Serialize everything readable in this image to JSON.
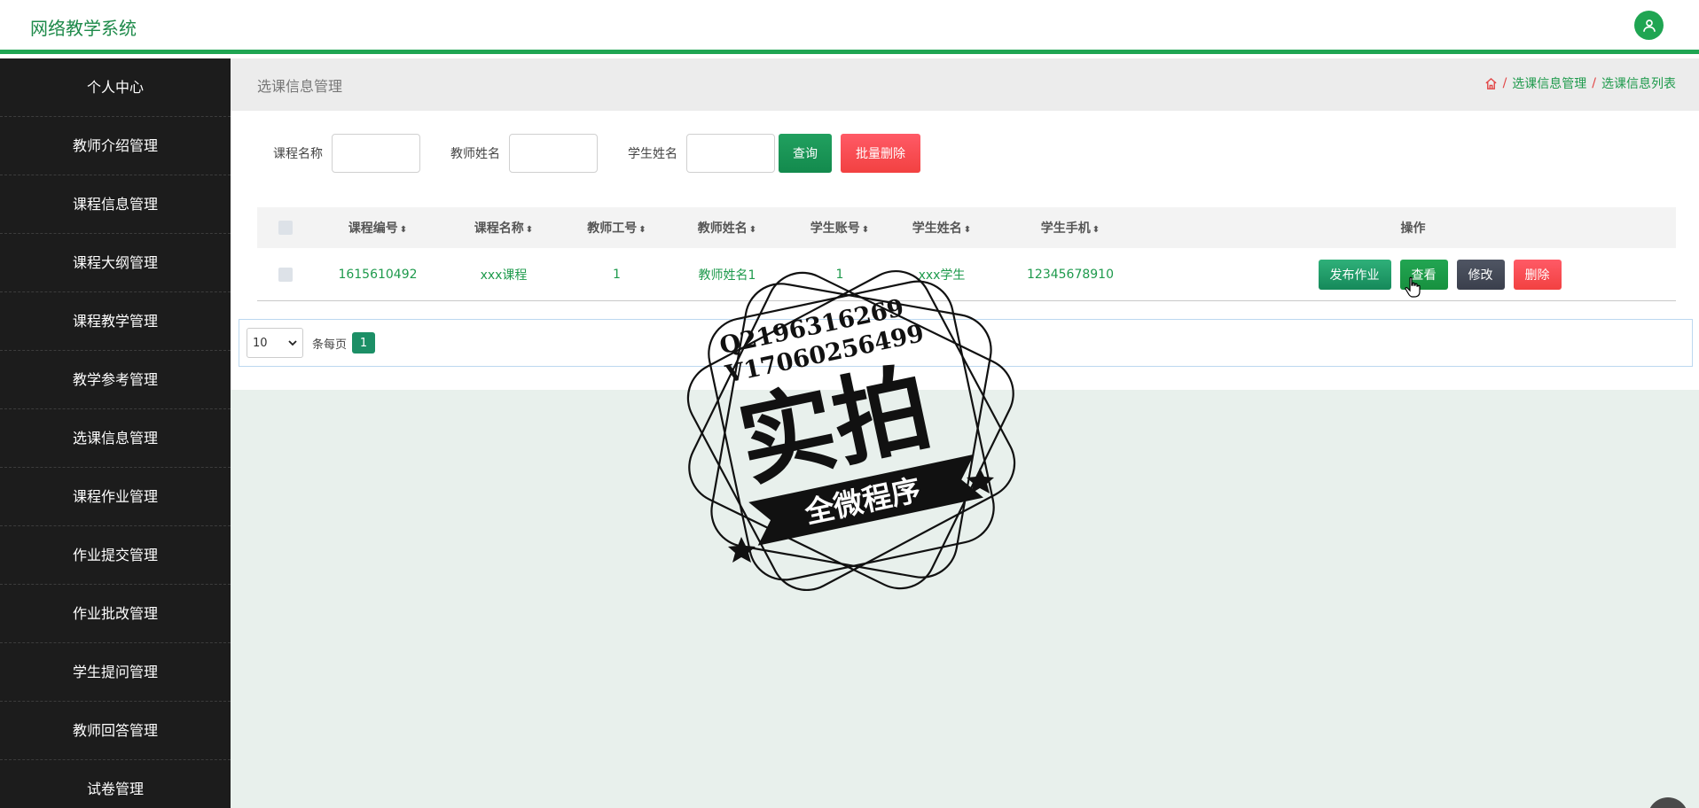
{
  "header": {
    "brand": "网络教学系统",
    "avatar_icon": "user-icon"
  },
  "sidebar": {
    "items": [
      {
        "label": "个人中心"
      },
      {
        "label": "教师介绍管理"
      },
      {
        "label": "课程信息管理"
      },
      {
        "label": "课程大纲管理"
      },
      {
        "label": "课程教学管理"
      },
      {
        "label": "教学参考管理"
      },
      {
        "label": "选课信息管理"
      },
      {
        "label": "课程作业管理"
      },
      {
        "label": "作业提交管理"
      },
      {
        "label": "作业批改管理"
      },
      {
        "label": "学生提问管理"
      },
      {
        "label": "教师回答管理"
      },
      {
        "label": "试卷管理"
      }
    ]
  },
  "page": {
    "title": "选课信息管理",
    "breadcrumb": [
      "选课信息管理",
      "选课信息列表"
    ]
  },
  "search": {
    "course_name_label": "课程名称",
    "teacher_name_label": "教师姓名",
    "student_name_label": "学生姓名",
    "query_label": "查询",
    "batch_delete_label": "批量删除"
  },
  "table": {
    "headers": [
      "课程编号",
      "课程名称",
      "教师工号",
      "教师姓名",
      "学生账号",
      "学生姓名",
      "学生手机",
      "操作"
    ],
    "rows": [
      {
        "course_no": "1615610492",
        "course_name": "xxx课程",
        "teacher_id": "1",
        "teacher_name": "教师姓名1",
        "student_account": "1",
        "student_name": "xxx学生",
        "student_phone": "12345678910"
      }
    ],
    "actions": [
      "发布作业",
      "查看",
      "修改",
      "删除"
    ]
  },
  "pager": {
    "page_size": "10",
    "per_page_label": "条每页",
    "current_page": "1"
  },
  "watermark": {
    "line1": "Q2196316269",
    "line2": "V17060256499",
    "big": "实拍",
    "ribbon": "全微程序"
  },
  "colors": {
    "accent": "#1fa552",
    "sidebar": "#1c1c1c",
    "danger": "#f24141",
    "dark": "#3a3f4c"
  }
}
